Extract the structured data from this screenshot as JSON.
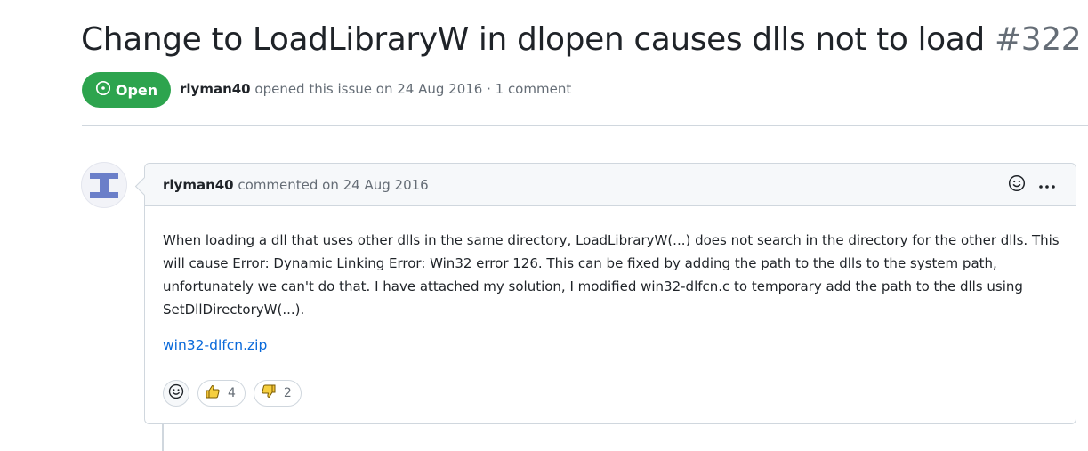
{
  "issue": {
    "title": "Change to LoadLibraryW in dlopen causes dlls not to load",
    "number": "#322",
    "state_label": "Open",
    "author": "rlyman40",
    "meta_text": " opened this issue on 24 Aug 2016 · 1 comment",
    "state_color": "#2da44e"
  },
  "comment": {
    "author": "rlyman40",
    "meta_text": " commented on 24 Aug 2016",
    "body": "When loading a dll that uses other dlls in the same directory, LoadLibraryW(...) does not search in the directory for the other dlls. This will cause Error: Dynamic Linking Error: Win32 error 126. This can be fixed by adding the path to the dlls to the system path, unfortunately we can't do that. I have attached my solution, I modified win32-dlfcn.c to temporary add the path to the dlls using SetDllDirectoryW(...).",
    "attachment": "win32-dlfcn.zip",
    "header_icons": [
      "smiley-icon",
      "kebab-menu-icon"
    ]
  },
  "reactions": [
    {
      "icon": "thumbs-up-icon",
      "count": "4"
    },
    {
      "icon": "thumbs-down-icon",
      "count": "2"
    }
  ],
  "colors": {
    "link": "#0969da",
    "muted": "#656d76",
    "border": "#d0d7de"
  }
}
